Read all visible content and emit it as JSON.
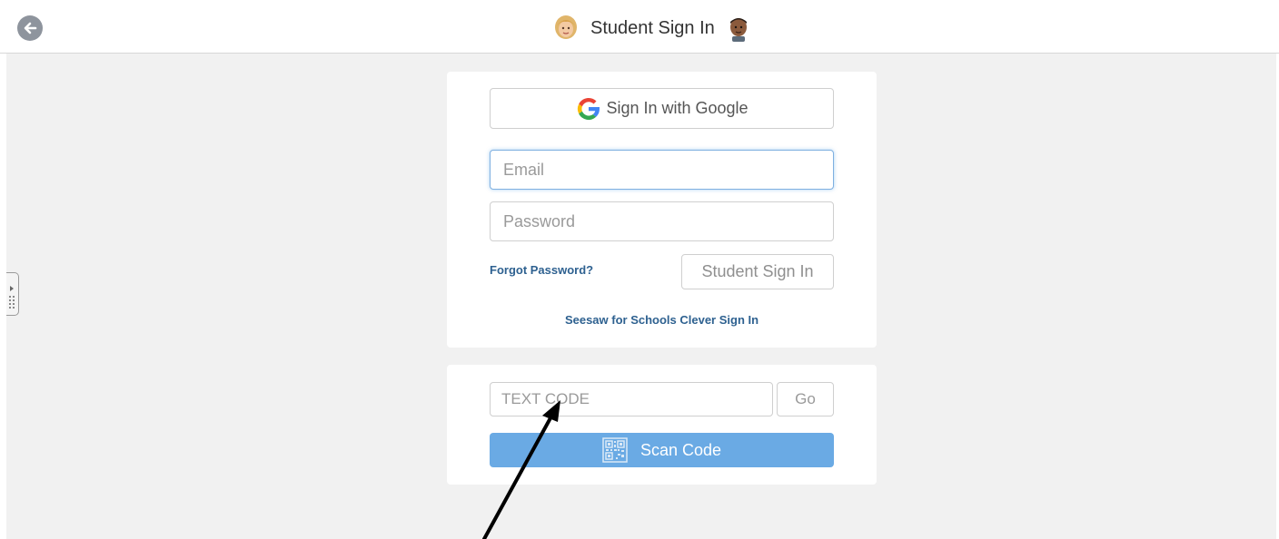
{
  "header": {
    "title": "Student Sign In",
    "back_icon": "back-arrow-icon",
    "left_avatar": "student-girl-avatar-icon",
    "right_avatar": "student-boy-avatar-icon"
  },
  "signin": {
    "google_label": "Sign In with Google",
    "email_placeholder": "Email",
    "password_placeholder": "Password",
    "forgot_label": "Forgot Password?",
    "submit_label": "Student Sign In",
    "clever_label": "Seesaw for Schools Clever Sign In"
  },
  "code": {
    "input_placeholder": "TEXT CODE",
    "go_label": "Go",
    "scan_label": "Scan Code"
  },
  "colors": {
    "accent_blue": "#6aaae4",
    "link_blue": "#2e6190",
    "background": "#f1f1f1"
  }
}
